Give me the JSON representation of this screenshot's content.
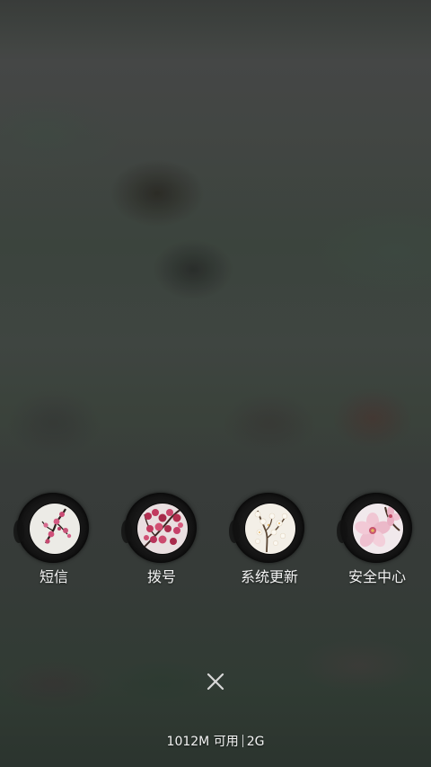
{
  "apps": [
    {
      "label": "短信",
      "icon": "plum-blossom-branch-icon"
    },
    {
      "label": "拨号",
      "icon": "red-plum-blossoms-icon"
    },
    {
      "label": "系统更新",
      "icon": "white-blossom-tree-icon"
    },
    {
      "label": "安全中心",
      "icon": "pink-cherry-blossom-icon"
    }
  ],
  "close_icon": "close-icon",
  "status": {
    "memory": "1012M 可用",
    "network": "2G"
  },
  "colors": {
    "ring": "#151515",
    "label": "#f2f2f2",
    "blossom_pink": "#c8557a",
    "blossom_red": "#b0304e"
  }
}
